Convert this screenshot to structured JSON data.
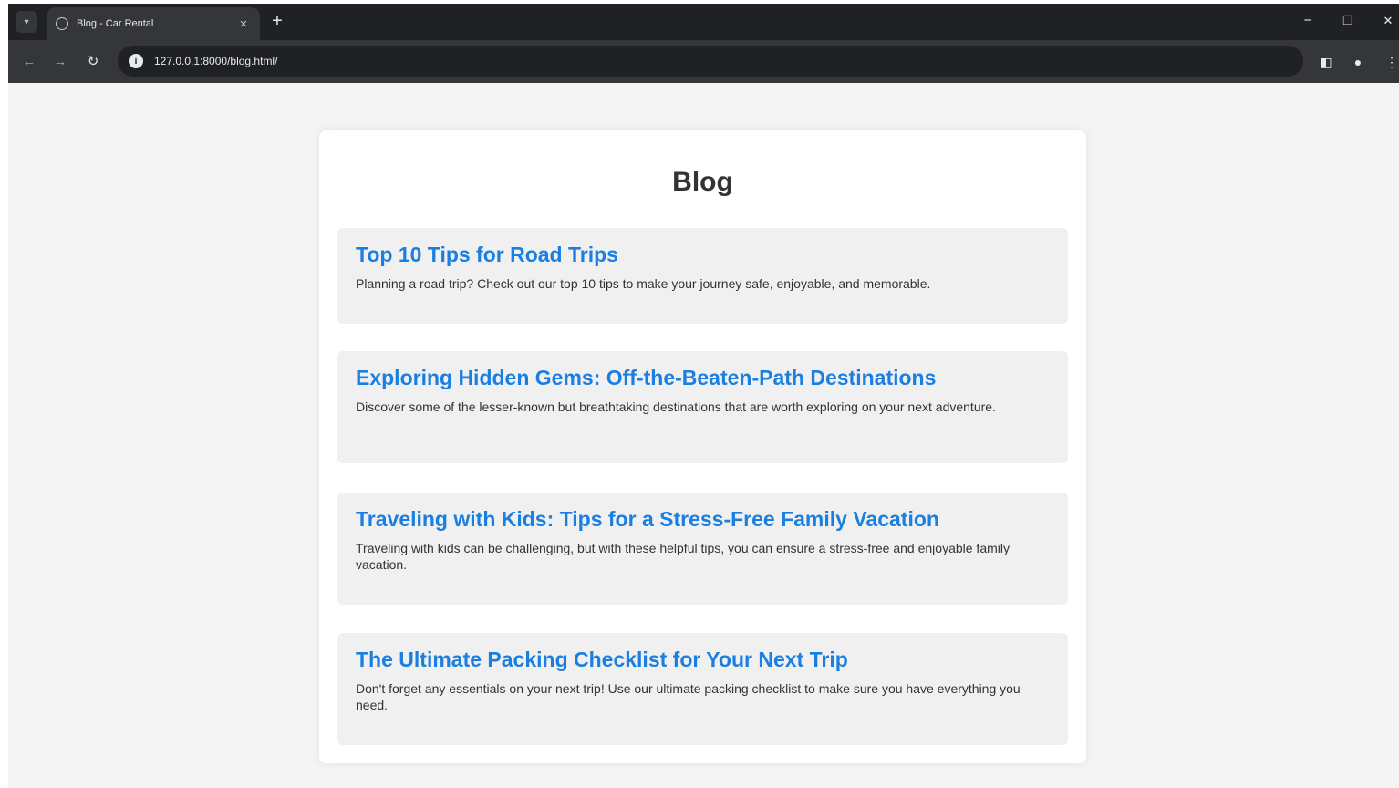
{
  "browser": {
    "tab_title": "Blog - Car Rental",
    "tab_close": "×",
    "new_tab": "+",
    "url": "127.0.0.1:8000/blog.html/",
    "controls": {
      "minimize": "−",
      "restore": "❐",
      "close": "✕"
    }
  },
  "page": {
    "title": "Blog",
    "posts": [
      {
        "title": "Top 10 Tips for Road Trips",
        "excerpt": "Planning a road trip? Check out our top 10 tips to make your journey safe, enjoyable, and memorable."
      },
      {
        "title": "Exploring Hidden Gems: Off-the-Beaten-Path Destinations",
        "excerpt": "Discover some of the lesser-known but breathtaking destinations that are worth exploring on your next adventure."
      },
      {
        "title": "Traveling with Kids: Tips for a Stress-Free Family Vacation",
        "excerpt": "Traveling with kids can be challenging, but with these helpful tips, you can ensure a stress-free and enjoyable family vacation."
      },
      {
        "title": "The Ultimate Packing Checklist for Your Next Trip",
        "excerpt": "Don't forget any essentials on your next trip! Use our ultimate packing checklist to make sure you have everything you need."
      }
    ]
  },
  "colors": {
    "link": "#1a7fe0",
    "page_background": "#f4f4f4",
    "card_background": "#ffffff",
    "post_background": "#f0f0f0"
  },
  "icons": [
    "tab-search-icon",
    "site-favicon",
    "back-icon",
    "forward-icon",
    "reload-icon",
    "site-info-icon",
    "side-panel-icon",
    "profile-icon",
    "menu-icon"
  ]
}
